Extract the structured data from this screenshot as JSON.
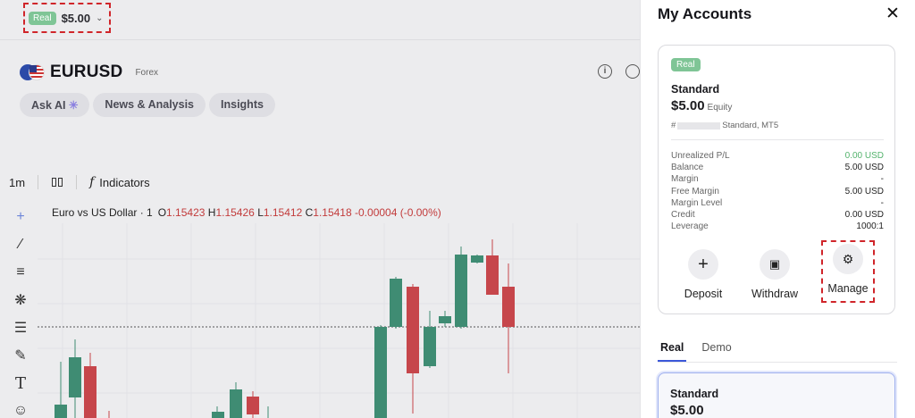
{
  "account_selector": {
    "badge": "Real",
    "amount": "$5.00",
    "chevron_icon": "chevron-down-icon"
  },
  "symbol": {
    "name": "EURUSD",
    "category": "Forex"
  },
  "pills": [
    {
      "label": "Ask AI"
    },
    {
      "label": "News & Analysis"
    },
    {
      "label": "Insights"
    }
  ],
  "toolbar": {
    "timeframe": "1m",
    "indicators_label": "Indicators"
  },
  "chart": {
    "legend_title": "Euro vs US Dollar · 1",
    "o_label": "O",
    "o_val": "1.15423",
    "h_label": "H",
    "h_val": "1.15426",
    "l_label": "L",
    "l_val": "1.15412",
    "c_label": "C",
    "c_val": "1.15418",
    "change": "-0.00004 (-0.00%)",
    "up_color": "#3f8c73",
    "down_color": "#c6464b"
  },
  "chart_data": {
    "type": "candlestick",
    "note_values": "approximate visible candles",
    "candles": [
      {
        "o": 1.1539,
        "h": 1.15395,
        "l": 1.1537,
        "c": 1.15385
      },
      {
        "o": 1.15385,
        "h": 1.154,
        "l": 1.15375,
        "c": 1.15395
      },
      {
        "o": 1.15395,
        "h": 1.15398,
        "l": 1.1537,
        "c": 1.15378
      },
      {
        "o": 1.1538,
        "h": 1.15385,
        "l": 1.15372,
        "c": 1.15376
      }
    ]
  },
  "panel": {
    "title": "My Accounts",
    "account": {
      "badge": "Real",
      "type": "Standard",
      "balance": "$5.00",
      "balance_sub": "Equity",
      "number_prefix": "#",
      "number_suffix": "Standard, MT5",
      "stats": [
        {
          "label": "Unrealized P/L",
          "value": "0.00 USD",
          "green": true
        },
        {
          "label": "Balance",
          "value": "5.00 USD"
        },
        {
          "label": "Margin",
          "value": "-"
        },
        {
          "label": "Free Margin",
          "value": "5.00 USD"
        },
        {
          "label": "Margin Level",
          "value": "-"
        },
        {
          "label": "Credit",
          "value": "0.00 USD"
        },
        {
          "label": "Leverage",
          "value": "1000:1"
        }
      ],
      "actions": [
        {
          "label": "Deposit"
        },
        {
          "label": "Withdraw"
        },
        {
          "label": "Manage"
        }
      ]
    },
    "tabs": [
      {
        "label": "Real"
      },
      {
        "label": "Demo"
      }
    ],
    "second_account": {
      "type": "Standard",
      "balance": "$5.00"
    }
  }
}
